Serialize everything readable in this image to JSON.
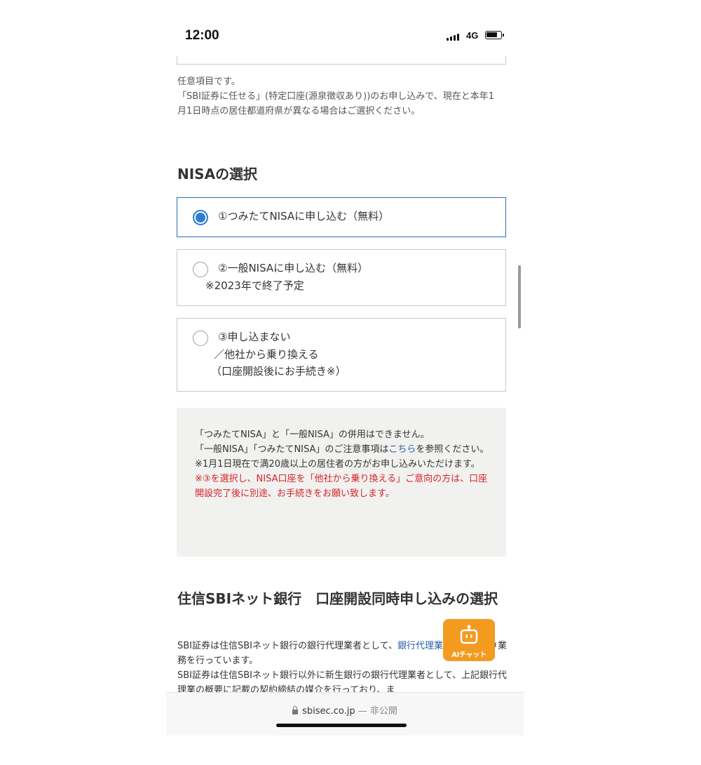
{
  "status_bar": {
    "time": "12:00",
    "network": "4G"
  },
  "notice": {
    "line1": "任意項目です。",
    "line2": "「SBI証券に任せる」(特定口座(源泉徴収あり))のお申し込みで、現在と本年1月1日時点の居住都道府県が異なる場合はご選択ください。"
  },
  "nisa": {
    "title": "NISAの選択",
    "options": [
      {
        "lines": [
          "①つみたてNISAに申し込む（無料）"
        ],
        "selected": true
      },
      {
        "lines": [
          "②一般NISAに申し込む（無料）",
          "※2023年で終了予定"
        ],
        "selected": false
      },
      {
        "lines": [
          "③申し込まない",
          "／他社から乗り換える",
          "（口座開設後にお手続き※）"
        ],
        "selected": false
      }
    ],
    "info": {
      "p1": "「つみたてNISA」と「一般NISA」の併用はできません。",
      "p2_pre": "「一般NISA」「つみたてNISA」のご注意事項は",
      "p2_link": "こちら",
      "p2_post": "を参照ください。",
      "p3": "※1月1日現在で満20歳以上の居住者の方がお申し込みいただけます。",
      "p4_red": "※③を選択し、NISA口座を「他社から乗り換える」ご意向の方は、口座開設完了後に別途、お手続きをお願い致します。"
    }
  },
  "bank": {
    "title": "住信SBIネット銀行　口座開設同時申し込みの選択",
    "text_pre": "SBI証券は住信SBIネット銀行の銀行代理業者として、",
    "text_link": "銀行代理業の概要",
    "text_mid": "の通り業務を行っています。",
    "text_2": "SBI証券は住信SBIネット銀行以外に新生銀行の銀行代理業者として、上記銀行代理業の概要に記載の契約締結の媒介を行っており、ま"
  },
  "ai_chat": {
    "label": "AIチャット",
    "icon": "robot-icon"
  },
  "browser": {
    "domain": "sbisec.co.jp",
    "separator": " — ",
    "visibility": "非公開"
  },
  "colors": {
    "accent": "#2e7dd7",
    "warning": "#d8232a",
    "chat_button": "#f39a1f",
    "link": "#2a5ea8"
  }
}
